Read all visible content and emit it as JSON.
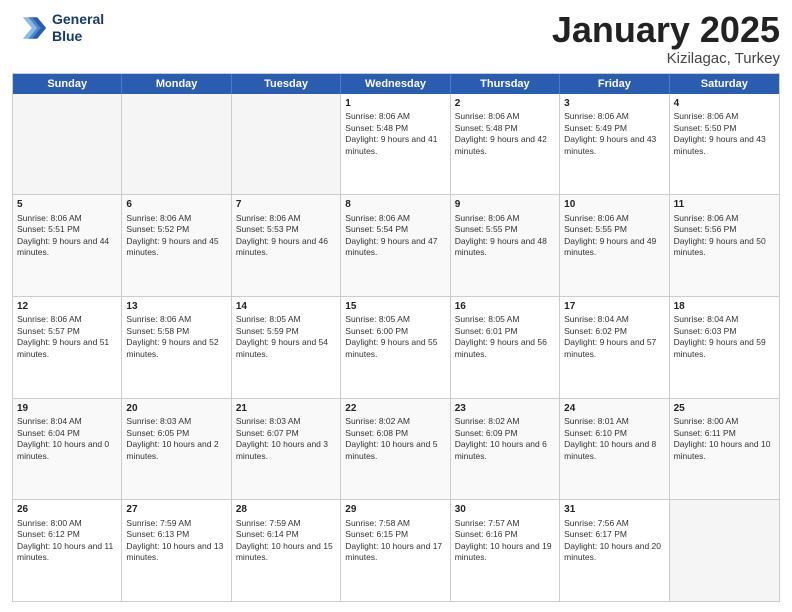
{
  "logo": {
    "line1": "General",
    "line2": "Blue"
  },
  "title": "January 2025",
  "subtitle": "Kizilagac, Turkey",
  "days": [
    "Sunday",
    "Monday",
    "Tuesday",
    "Wednesday",
    "Thursday",
    "Friday",
    "Saturday"
  ],
  "weeks": [
    [
      {
        "day": "",
        "content": ""
      },
      {
        "day": "",
        "content": ""
      },
      {
        "day": "",
        "content": ""
      },
      {
        "day": "1",
        "content": "Sunrise: 8:06 AM\nSunset: 5:48 PM\nDaylight: 9 hours and 41 minutes."
      },
      {
        "day": "2",
        "content": "Sunrise: 8:06 AM\nSunset: 5:48 PM\nDaylight: 9 hours and 42 minutes."
      },
      {
        "day": "3",
        "content": "Sunrise: 8:06 AM\nSunset: 5:49 PM\nDaylight: 9 hours and 43 minutes."
      },
      {
        "day": "4",
        "content": "Sunrise: 8:06 AM\nSunset: 5:50 PM\nDaylight: 9 hours and 43 minutes."
      }
    ],
    [
      {
        "day": "5",
        "content": "Sunrise: 8:06 AM\nSunset: 5:51 PM\nDaylight: 9 hours and 44 minutes."
      },
      {
        "day": "6",
        "content": "Sunrise: 8:06 AM\nSunset: 5:52 PM\nDaylight: 9 hours and 45 minutes."
      },
      {
        "day": "7",
        "content": "Sunrise: 8:06 AM\nSunset: 5:53 PM\nDaylight: 9 hours and 46 minutes."
      },
      {
        "day": "8",
        "content": "Sunrise: 8:06 AM\nSunset: 5:54 PM\nDaylight: 9 hours and 47 minutes."
      },
      {
        "day": "9",
        "content": "Sunrise: 8:06 AM\nSunset: 5:55 PM\nDaylight: 9 hours and 48 minutes."
      },
      {
        "day": "10",
        "content": "Sunrise: 8:06 AM\nSunset: 5:55 PM\nDaylight: 9 hours and 49 minutes."
      },
      {
        "day": "11",
        "content": "Sunrise: 8:06 AM\nSunset: 5:56 PM\nDaylight: 9 hours and 50 minutes."
      }
    ],
    [
      {
        "day": "12",
        "content": "Sunrise: 8:06 AM\nSunset: 5:57 PM\nDaylight: 9 hours and 51 minutes."
      },
      {
        "day": "13",
        "content": "Sunrise: 8:06 AM\nSunset: 5:58 PM\nDaylight: 9 hours and 52 minutes."
      },
      {
        "day": "14",
        "content": "Sunrise: 8:05 AM\nSunset: 5:59 PM\nDaylight: 9 hours and 54 minutes."
      },
      {
        "day": "15",
        "content": "Sunrise: 8:05 AM\nSunset: 6:00 PM\nDaylight: 9 hours and 55 minutes."
      },
      {
        "day": "16",
        "content": "Sunrise: 8:05 AM\nSunset: 6:01 PM\nDaylight: 9 hours and 56 minutes."
      },
      {
        "day": "17",
        "content": "Sunrise: 8:04 AM\nSunset: 6:02 PM\nDaylight: 9 hours and 57 minutes."
      },
      {
        "day": "18",
        "content": "Sunrise: 8:04 AM\nSunset: 6:03 PM\nDaylight: 9 hours and 59 minutes."
      }
    ],
    [
      {
        "day": "19",
        "content": "Sunrise: 8:04 AM\nSunset: 6:04 PM\nDaylight: 10 hours and 0 minutes."
      },
      {
        "day": "20",
        "content": "Sunrise: 8:03 AM\nSunset: 6:05 PM\nDaylight: 10 hours and 2 minutes."
      },
      {
        "day": "21",
        "content": "Sunrise: 8:03 AM\nSunset: 6:07 PM\nDaylight: 10 hours and 3 minutes."
      },
      {
        "day": "22",
        "content": "Sunrise: 8:02 AM\nSunset: 6:08 PM\nDaylight: 10 hours and 5 minutes."
      },
      {
        "day": "23",
        "content": "Sunrise: 8:02 AM\nSunset: 6:09 PM\nDaylight: 10 hours and 6 minutes."
      },
      {
        "day": "24",
        "content": "Sunrise: 8:01 AM\nSunset: 6:10 PM\nDaylight: 10 hours and 8 minutes."
      },
      {
        "day": "25",
        "content": "Sunrise: 8:00 AM\nSunset: 6:11 PM\nDaylight: 10 hours and 10 minutes."
      }
    ],
    [
      {
        "day": "26",
        "content": "Sunrise: 8:00 AM\nSunset: 6:12 PM\nDaylight: 10 hours and 11 minutes."
      },
      {
        "day": "27",
        "content": "Sunrise: 7:59 AM\nSunset: 6:13 PM\nDaylight: 10 hours and 13 minutes."
      },
      {
        "day": "28",
        "content": "Sunrise: 7:59 AM\nSunset: 6:14 PM\nDaylight: 10 hours and 15 minutes."
      },
      {
        "day": "29",
        "content": "Sunrise: 7:58 AM\nSunset: 6:15 PM\nDaylight: 10 hours and 17 minutes."
      },
      {
        "day": "30",
        "content": "Sunrise: 7:57 AM\nSunset: 6:16 PM\nDaylight: 10 hours and 19 minutes."
      },
      {
        "day": "31",
        "content": "Sunrise: 7:56 AM\nSunset: 6:17 PM\nDaylight: 10 hours and 20 minutes."
      },
      {
        "day": "",
        "content": ""
      }
    ]
  ]
}
